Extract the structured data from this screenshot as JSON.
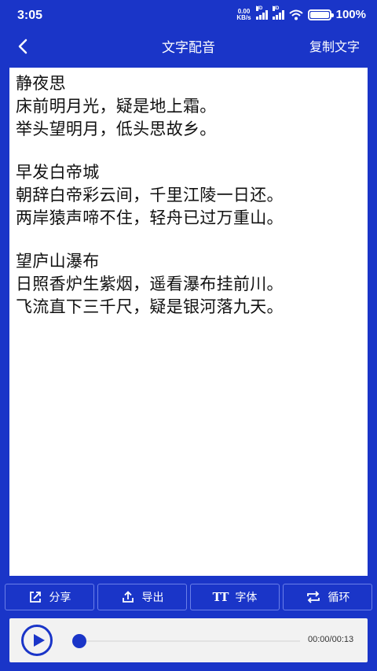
{
  "status_bar": {
    "time": "3:05",
    "net_speed_value": "0.00",
    "net_speed_unit": "KB/s",
    "signal_tag_1": "HD",
    "signal_tag_2": "HD",
    "battery": "100%",
    "battery_level": 1.0
  },
  "nav": {
    "title": "文字配音",
    "copy_label": "复制文字"
  },
  "poems": [
    {
      "title": "静夜思",
      "lines": [
        "床前明月光，疑是地上霜。",
        "举头望明月，低头思故乡。"
      ]
    },
    {
      "title": "早发白帝城",
      "lines": [
        "朝辞白帝彩云间，千里江陵一日还。",
        "两岸猿声啼不住，轻舟已过万重山。"
      ]
    },
    {
      "title": "望庐山瀑布",
      "lines": [
        "日照香炉生紫烟，遥看瀑布挂前川。",
        "飞流直下三千尺，疑是银河落九天。"
      ]
    }
  ],
  "toolbar": {
    "share_label": "分享",
    "export_label": "导出",
    "font_label": "字体",
    "font_icon_text": "TT",
    "loop_label": "循环"
  },
  "player": {
    "time": "00:00/00:13",
    "progress": 0.0
  },
  "icons": {
    "back": "chevron-left-icon",
    "share": "share-icon",
    "export": "upload-icon",
    "font": "font-size-icon",
    "loop": "loop-icon",
    "play": "play-icon"
  },
  "colors": {
    "primary": "#1a35c8",
    "background_content": "#ffffff",
    "player_bg": "#f2f2f2"
  }
}
